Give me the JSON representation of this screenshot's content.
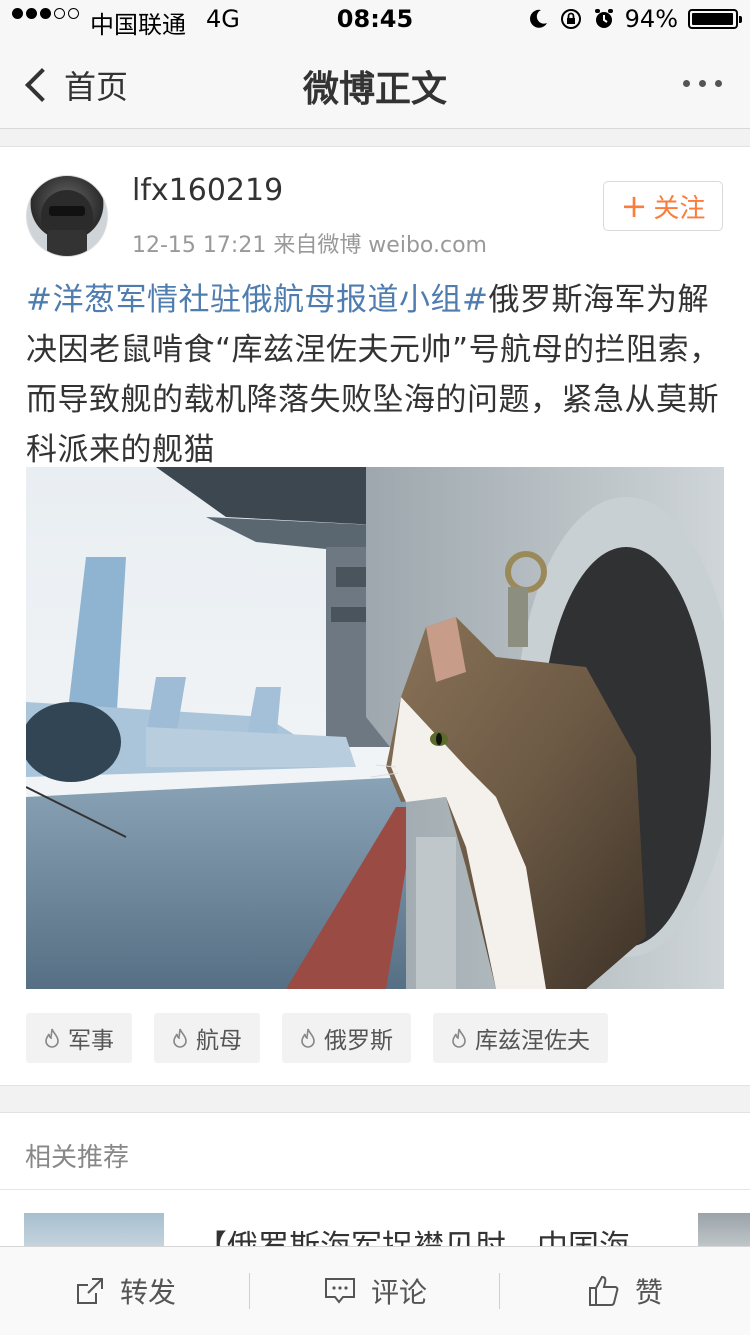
{
  "status_bar": {
    "carrier": "中国联通",
    "network": "4G",
    "time": "08:45",
    "battery": "94%",
    "battery_level": 0.94,
    "signal_bars_filled": 3,
    "signal_bars_total": 5,
    "icons": [
      "moon-icon",
      "rotation-lock-icon",
      "alarm-icon",
      "battery-icon"
    ]
  },
  "nav": {
    "back_label": "首页",
    "title": "微博正文",
    "more_icon": "more-dots-icon"
  },
  "post": {
    "username": "lfx160219",
    "meta": "12-15 17:21  来自微博 weibo.com",
    "follow_label": "关注",
    "hashtag": "#洋葱军情社驻俄航母报道小组#",
    "body": "俄罗斯海军为解决因老鼠啃食“库兹涅佐夫元帅”号航母的拦阻索，而导致舰的载机降落失败坠海的问题，紧急从莫斯科派来的舰猫",
    "tags": [
      "军事",
      "航母",
      "俄罗斯",
      "库兹涅佐夫"
    ]
  },
  "related": {
    "title": "相关推荐",
    "item_text": "【俄罗斯海军捉襟见肘，中国海"
  },
  "toolbar": {
    "repost": "转发",
    "comment": "评论",
    "like": "赞"
  },
  "colors": {
    "accent_orange": "#fa7d3c",
    "hashtag_blue": "#507daf"
  }
}
